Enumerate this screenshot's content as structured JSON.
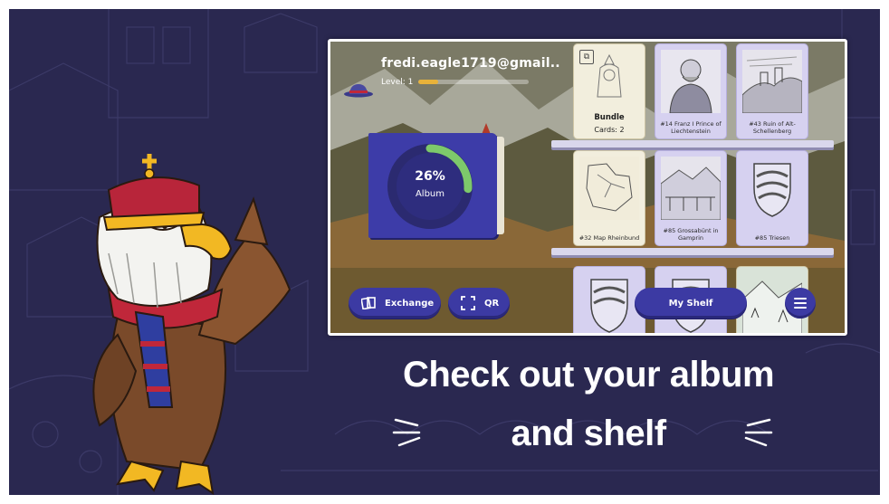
{
  "profile": {
    "username": "fredi.eagle1719@gmail..",
    "level_label": "Level: 1",
    "level_progress": 0.18
  },
  "album": {
    "percent_label": "26%",
    "percent": 26,
    "label": "Album"
  },
  "shelf": {
    "row1": [
      {
        "type": "bundle",
        "title": "Bundle",
        "count_label": "Cards: 2"
      },
      {
        "caption": "#14 Franz I Prince of Liechtenstein"
      },
      {
        "caption": "#43 Ruin of Alt-Schellenberg"
      }
    ],
    "row2": [
      {
        "caption": "#32 Map Rheinbund"
      },
      {
        "caption": "#85 Grossabünt in Gamprin"
      },
      {
        "caption": "#85 Triesen"
      }
    ]
  },
  "buttons": {
    "exchange": "Exchange",
    "qr": "QR",
    "my_shelf": "My Shelf"
  },
  "headline": {
    "line1": "Check out your album",
    "line2": "and shelf"
  },
  "colors": {
    "background": "#2a2850",
    "button": "#3c3aa3",
    "album_ring": "#7dc96b",
    "level_bar": "#e8b23a",
    "shelf": "#d9d7ec"
  },
  "icons": [
    "exchange-cards-icon",
    "qr-scan-icon",
    "menu-icon",
    "bundle-icon",
    "hat-icon"
  ]
}
